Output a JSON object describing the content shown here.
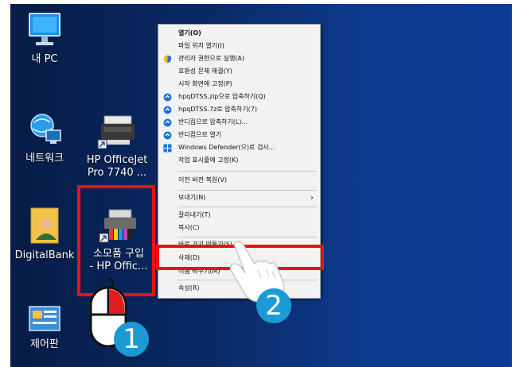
{
  "desktop": {
    "icons": [
      {
        "label": "내 PC"
      },
      {
        "label": "네트워크"
      },
      {
        "label": "HP OfficeJet\nPro 7740 ..."
      },
      {
        "label": "DigitalBank"
      },
      {
        "label": "소모품 구입\n- HP Offic..."
      },
      {
        "label": "제어판"
      }
    ]
  },
  "context_menu": {
    "items": [
      {
        "label": "열기(O)",
        "icon": "none"
      },
      {
        "label": "파일 위치 열기(I)",
        "icon": "none"
      },
      {
        "label": "관리자 권한으로 실행(A)",
        "icon": "shield-icon"
      },
      {
        "label": "호환성 문제 해결(Y)",
        "icon": "none"
      },
      {
        "label": "시작 화면에 고정(P)",
        "icon": "none"
      },
      {
        "label": "hpqDTSS.zip으로 압축하기(Q)",
        "icon": "bandizip-icon"
      },
      {
        "label": "hpqDTSS.7z로 압축하기(7)",
        "icon": "bandizip-icon"
      },
      {
        "label": "반디집으로 압축하기(L)...",
        "icon": "bandizip-icon"
      },
      {
        "label": "반디집으로 열기",
        "icon": "bandizip-icon"
      },
      {
        "label": "Windows Defender(으)로 검사...",
        "icon": "defender-icon"
      },
      {
        "label": "작업 표시줄에 고정(K)",
        "icon": "none"
      },
      {
        "label": "이전 버전 복원(V)",
        "icon": "none"
      },
      {
        "label": "보내기(N)",
        "icon": "none"
      },
      {
        "label": "잘라내기(T)",
        "icon": "none"
      },
      {
        "label": "복사(C)",
        "icon": "none"
      },
      {
        "label": "바로 가기 만들기(S)",
        "icon": "none"
      },
      {
        "label": "삭제(D)",
        "icon": "none"
      },
      {
        "label": "이름 바꾸기(M)",
        "icon": "none"
      },
      {
        "label": "속성(R)",
        "icon": "none"
      }
    ]
  },
  "annotations": {
    "step1": "1",
    "step2": "2"
  },
  "colors": {
    "highlight": "#ec1111",
    "badge": "#1b9ad6"
  }
}
